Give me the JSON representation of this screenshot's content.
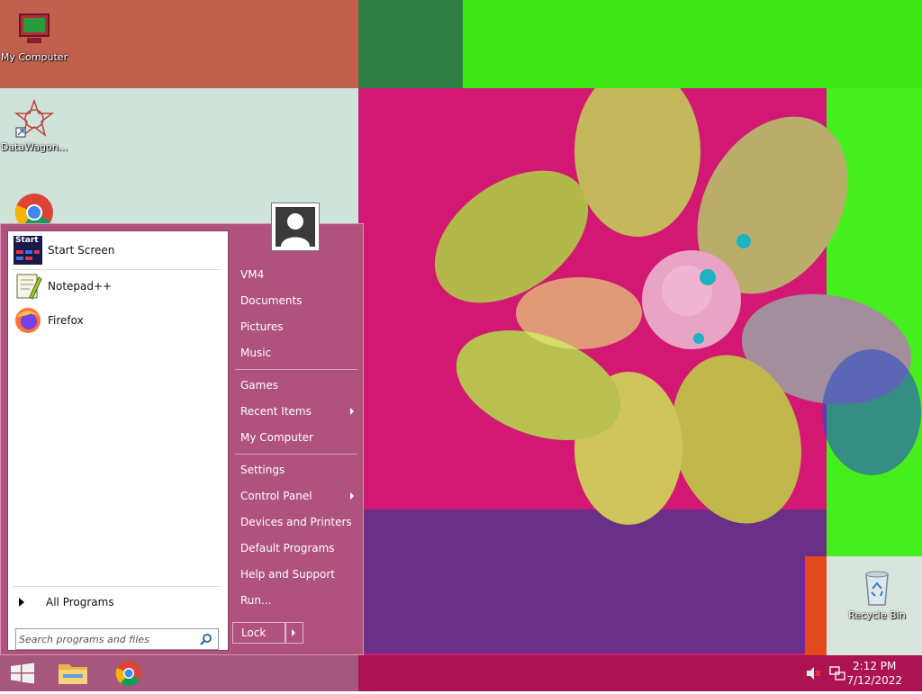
{
  "desktop": {
    "icons": [
      {
        "label": "My Computer",
        "icon": "computer-icon"
      },
      {
        "label": "DataWagon...",
        "icon": "datawagon-icon"
      },
      {
        "label": "",
        "icon": "chrome-icon"
      },
      {
        "label": "Recycle Bin",
        "icon": "recycle-bin-icon"
      }
    ]
  },
  "start_menu": {
    "pinned": [
      {
        "label": "Start Screen",
        "icon": "start-screen-icon",
        "icon_text": "Start"
      },
      {
        "label": "Notepad++",
        "icon": "notepadpp-icon"
      },
      {
        "label": "Firefox",
        "icon": "firefox-icon"
      }
    ],
    "all_programs": "All Programs",
    "search_placeholder": "Search programs and files",
    "right": {
      "user": "VM4",
      "documents": "Documents",
      "pictures": "Pictures",
      "music": "Music",
      "games": "Games",
      "recent_items": "Recent Items",
      "my_computer": "My Computer",
      "settings": "Settings",
      "control_panel": "Control Panel",
      "devices_printers": "Devices and Printers",
      "default_programs": "Default Programs",
      "help_support": "Help and Support",
      "run": "Run..."
    },
    "lock_label": "Lock"
  },
  "taskbar": {
    "buttons": [
      "windows-start-icon",
      "file-explorer-icon",
      "chrome-icon"
    ],
    "time": "2:12 PM",
    "date": "7/12/2022",
    "tray": [
      "volume-muted-icon",
      "network-icon"
    ]
  },
  "colors": {
    "start_menu_bg": "#b0527e",
    "taskbar_left": "#a6577c",
    "taskbar_right": "#ad1251"
  }
}
